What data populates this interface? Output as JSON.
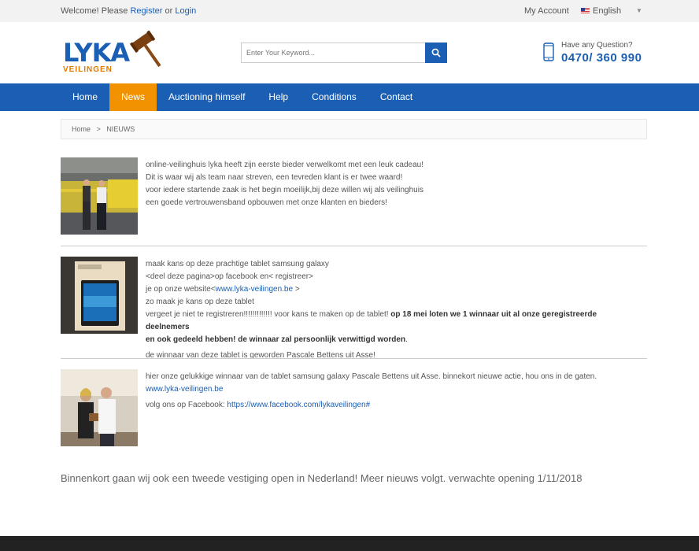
{
  "topbar": {
    "welcome_prefix": "Welcome! Please",
    "register": "Register",
    "or": "or",
    "login": "Login",
    "my_account": "My Account",
    "language": "English"
  },
  "header": {
    "logo_text": "LYKA",
    "logo_sub": "VEILINGEN",
    "search_placeholder": "Enter Your Keyword...",
    "question": "Have any Question?",
    "phone": "0470/ 360 990"
  },
  "nav": {
    "items": [
      "Home",
      "News",
      "Auctioning himself",
      "Help",
      "Conditions",
      "Contact"
    ],
    "active": "News"
  },
  "breadcrumb": {
    "home": "Home",
    "separator": ">",
    "current": "NIEUWS"
  },
  "posts": [
    {
      "lines": [
        "online-veilinghuis lyka heeft zijn eerste bieder verwelkomt met een leuk cadeau!",
        "Dit is waar wij als team naar streven, een tevreden klant is er twee waard!",
        "voor iedere startende zaak is het begin moeilijk,bij deze willen wij als veilinghuis",
        "een goede vertrouwensband opbouwen met onze klanten en bieders!"
      ]
    },
    {
      "line1": "maak kans op deze prachtige tablet samsung galaxy",
      "line2": "<deel deze pagina>op facebook en< registreer>",
      "line3_prefix": "je op onze website<",
      "line3_link": "www.lyka-veilingen.be",
      "line3_suffix": ">",
      "line4": "zo maak je kans op deze tablet",
      "line5_normal": "vergeet je niet te registreren!!!!!!!!!!!!! voor kans te maken op de tablet!",
      "line5_bold": "op 18 mei loten we 1 winnaar uit al onze geregistreerde deelnemers",
      "line6_bold": "en ook gedeeld hebben! de winnaar zal persoonlijk verwittigd worden",
      "line6_end": ".",
      "line7": "de winnaar van deze tablet is geworden Pascale Bettens uit Asse!"
    },
    {
      "line1_text": "hier onze gelukkige winnaar van de tablet samsung galaxy Pascale Bettens uit Asse. binnekort nieuwe actie, hou ons in de gaten.",
      "line1_link": "www.lyka-veilingen.be",
      "line2_prefix": "volg ons op Facebook:",
      "line2_link": "https://www.facebook.com/lykaveilingen#"
    }
  ],
  "footer_note": "Binnenkort gaan wij ook een tweede vestiging open in Nederland! Meer nieuws volgt. verwachte opening 1/11/2018"
}
